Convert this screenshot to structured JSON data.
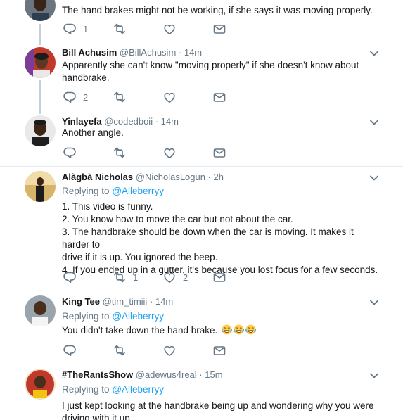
{
  "tweets": [
    {
      "text": "The hand brakes might not be working, if she says it was moving properly.",
      "reply_count": "1"
    },
    {
      "name": "Bill Achusim",
      "handle": "@BillAchusim",
      "time": "· 14m",
      "lines": [
        "Apparently she can't know \"moving properly\" if she doesn't know about",
        "handbrake."
      ],
      "reply_count": "2"
    },
    {
      "name": "Yinlayefa",
      "handle": "@codedboii",
      "time": "· 14m",
      "lines": [
        "Another angle."
      ]
    },
    {
      "name": "Alàgbà Nicholas",
      "handle": "@NicholasLogun",
      "time": "· 2h",
      "replying_label": "Replying to",
      "replying_to": "@Alleberryy",
      "lines": [
        "1. This video is funny.",
        "2. You know how to move the car but not about the car.",
        "3. The handbrake should be down when the car is moving. It makes it harder to",
        "drive if it is up. You ignored the beep.",
        "4. If you ended up in a gutter, it's because you lost focus for a few seconds."
      ],
      "retweet_count": "1",
      "like_count": "2"
    },
    {
      "name": "King Tee",
      "handle": "@tim_timiii",
      "time": "· 14m",
      "replying_label": "Replying to",
      "replying_to": "@Alleberryy",
      "text": "You didn't take down the hand brake."
    },
    {
      "name": "#TheRantsShow",
      "handle": "@adewus4real",
      "time": "· 15m",
      "replying_label": "Replying to",
      "replying_to": "@Alleberryy",
      "lines": [
        "I just kept looking at the handbrake being up and wondering why you were",
        "driving with it up"
      ]
    }
  ],
  "icons": {
    "reply": "reply-icon",
    "retweet": "retweet-icon",
    "like": "heart-icon",
    "dm": "envelope-icon",
    "more": "chevron-down-icon",
    "emoji": "face-with-tears-of-joy-icon"
  },
  "colors": {
    "link": "#1da1f2",
    "muted": "#657786",
    "thread_line": "#c4cfd6",
    "divider": "#e6ecf0"
  }
}
